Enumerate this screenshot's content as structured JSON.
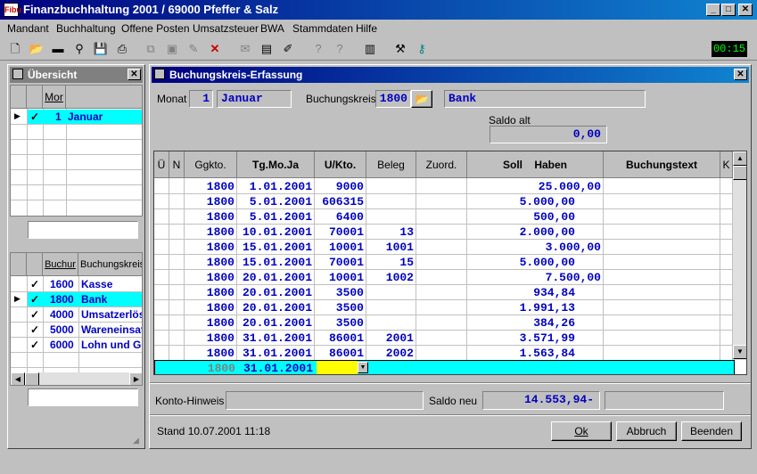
{
  "window": {
    "title": "Finanzbuchhaltung 2001 / 69000 Pfeffer & Salz",
    "icon_text": "Fibu"
  },
  "menu": [
    "Mandant",
    "Buchhaltung",
    "Offene Posten",
    "Umsatzsteuer",
    "BWA",
    "Stammdaten",
    "Hilfe"
  ],
  "clock": "00:15",
  "uebersicht": {
    "title": "Übersicht",
    "month_header": "Mor",
    "months": [
      {
        "checked": "✓",
        "num": "1",
        "name": "Januar"
      }
    ],
    "bk_headers": [
      "Buchur",
      "Buchungskreis"
    ],
    "bks": [
      {
        "checked": "✓",
        "num": "1600",
        "name": "Kasse"
      },
      {
        "checked": "✓",
        "num": "1800",
        "name": "Bank"
      },
      {
        "checked": "✓",
        "num": "4000",
        "name": "Umsatzerlös"
      },
      {
        "checked": "✓",
        "num": "5000",
        "name": "Wareneinsat"
      },
      {
        "checked": "✓",
        "num": "6000",
        "name": "Lohn und Geh"
      }
    ]
  },
  "erfassung": {
    "title": "Buchungskreis-Erfassung",
    "monat_label": "Monat",
    "monat_num": "1",
    "monat_name": "Januar",
    "bk_label": "Buchungskreis",
    "bk_num": "1800",
    "bk_name": "Bank",
    "saldo_alt_label": "Saldo alt",
    "saldo_alt": "0,00",
    "columns": [
      "Ü",
      "N",
      "Ggkto.",
      "Tg.Mo.Ja",
      "U/Kto.",
      "Beleg",
      "Zuord.",
      "Soll    Haben",
      "Buchungstext",
      "K"
    ],
    "rows": [
      {
        "gg": "1800",
        "date": "1.01.2001",
        "ukto": "9000",
        "beleg": "",
        "soll": "",
        "haben": "25.000,00"
      },
      {
        "gg": "1800",
        "date": "5.01.2001",
        "ukto": "606315",
        "beleg": "",
        "soll": "5.000,00",
        "haben": ""
      },
      {
        "gg": "1800",
        "date": "5.01.2001",
        "ukto": "6400",
        "beleg": "",
        "soll": "500,00",
        "haben": ""
      },
      {
        "gg": "1800",
        "date": "10.01.2001",
        "ukto": "70001",
        "beleg": "13",
        "soll": "2.000,00",
        "haben": ""
      },
      {
        "gg": "1800",
        "date": "15.01.2001",
        "ukto": "10001",
        "beleg": "1001",
        "soll": "",
        "haben": "3.000,00"
      },
      {
        "gg": "1800",
        "date": "15.01.2001",
        "ukto": "70001",
        "beleg": "15",
        "soll": "5.000,00",
        "haben": ""
      },
      {
        "gg": "1800",
        "date": "20.01.2001",
        "ukto": "10001",
        "beleg": "1002",
        "soll": "",
        "haben": "7.500,00"
      },
      {
        "gg": "1800",
        "date": "20.01.2001",
        "ukto": "3500",
        "beleg": "",
        "soll": "934,84",
        "haben": ""
      },
      {
        "gg": "1800",
        "date": "20.01.2001",
        "ukto": "3500",
        "beleg": "",
        "soll": "1.991,13",
        "haben": ""
      },
      {
        "gg": "1800",
        "date": "20.01.2001",
        "ukto": "3500",
        "beleg": "",
        "soll": "384,26",
        "haben": ""
      },
      {
        "gg": "1800",
        "date": "31.01.2001",
        "ukto": "86001",
        "beleg": "2001",
        "soll": "3.571,99",
        "haben": ""
      },
      {
        "gg": "1800",
        "date": "31.01.2001",
        "ukto": "86001",
        "beleg": "2002",
        "soll": "1.563,84",
        "haben": ""
      }
    ],
    "edit_row": {
      "gg": "1800",
      "date": "31.01.2001",
      "ukto": ""
    },
    "konto_hinweis_label": "Konto-Hinweis",
    "saldo_neu_label": "Saldo neu",
    "saldo_neu": "14.553,94-",
    "stand": "Stand 10.07.2001 11:18",
    "buttons": {
      "ok": "Ok",
      "abbruch": "Abbruch",
      "beenden": "Beenden"
    }
  }
}
